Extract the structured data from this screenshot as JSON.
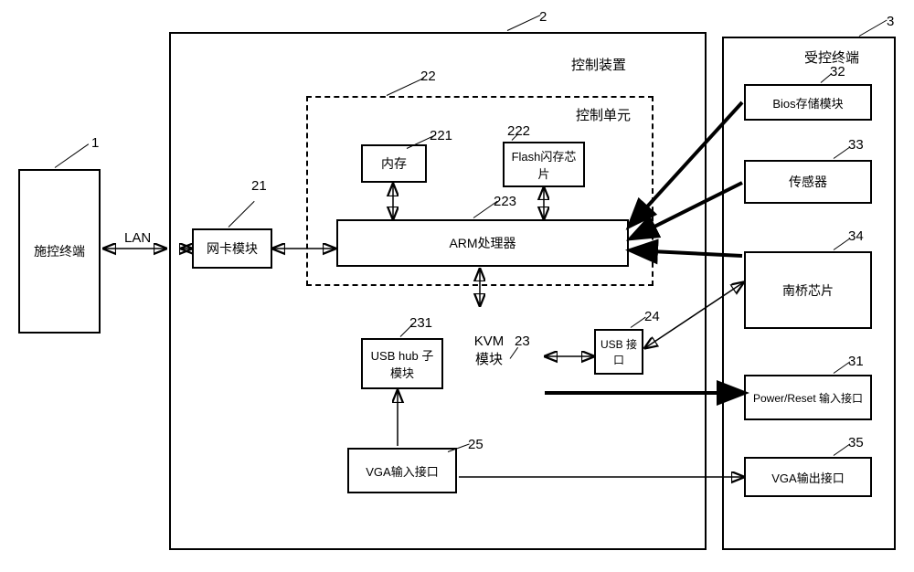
{
  "diagram": {
    "outer_labels": {
      "n1": "1",
      "n2": "2",
      "n3": "3",
      "n21": "21",
      "n22": "22",
      "n23": "23",
      "n24": "24",
      "n25": "25",
      "n31": "31",
      "n32": "32",
      "n33": "33",
      "n34": "34",
      "n35": "35",
      "n221": "221",
      "n222": "222",
      "n223": "223",
      "n231": "231"
    },
    "blocks": {
      "controlling_terminal": "施控终端",
      "lan_label": "LAN",
      "nic_module": "网卡模块",
      "control_device_title": "控制装置",
      "control_unit_title": "控制单元",
      "memory": "内存",
      "flash_chip": "Flash闪存芯片",
      "arm_processor": "ARM处理器",
      "usb_hub_sub": "USB hub 子模块",
      "kvm_module": "KVM 模块",
      "usb_port": "USB 接口",
      "vga_input": "VGA输入接口",
      "controlled_terminal_title": "受控终端",
      "bios_storage": "Bios存储模块",
      "sensor": "传感器",
      "south_bridge": "南桥芯片",
      "power_reset": "Power/Reset 输入接口",
      "vga_output": "VGA输出接口"
    }
  }
}
